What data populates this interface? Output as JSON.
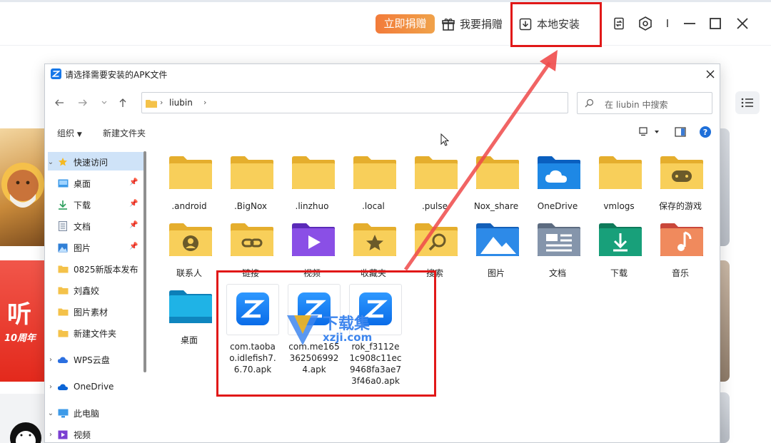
{
  "app": {
    "donate_now": "立即捐赠",
    "want_donate": "我要捐赠",
    "local_install": "本地安装",
    "separator": "I"
  },
  "dialog": {
    "title": "请选择需要安装的APK文件",
    "path_segment": "liubin",
    "search_placeholder": "在 liubin 中搜索",
    "organize": "组织",
    "new_folder": "新建文件夹"
  },
  "nav": {
    "items": [
      {
        "label": "快速访问"
      },
      {
        "label": "桌面"
      },
      {
        "label": "下载"
      },
      {
        "label": "文档"
      },
      {
        "label": "图片"
      },
      {
        "label": "0825新版本发布"
      },
      {
        "label": "刘鑫姣"
      },
      {
        "label": "图片素材"
      },
      {
        "label": "新建文件夹"
      },
      {
        "label": "WPS云盘"
      },
      {
        "label": "OneDrive"
      },
      {
        "label": "此电脑"
      },
      {
        "label": "视频"
      }
    ]
  },
  "files": {
    "row1": [
      {
        "label": ".android"
      },
      {
        "label": ".BigNox"
      },
      {
        "label": ".linzhuo"
      },
      {
        "label": ".local"
      },
      {
        "label": ".pulse"
      },
      {
        "label": "Nox_share"
      },
      {
        "label": "OneDrive"
      },
      {
        "label": "vmlogs"
      },
      {
        "label": "保存的游戏"
      }
    ],
    "row2": [
      {
        "label": "联系人"
      },
      {
        "label": "链接"
      },
      {
        "label": "视频"
      },
      {
        "label": "收藏夹"
      },
      {
        "label": "搜索"
      },
      {
        "label": "图片"
      },
      {
        "label": "文档"
      },
      {
        "label": "下载"
      },
      {
        "label": "音乐"
      }
    ],
    "row3": [
      {
        "label": "桌面"
      }
    ],
    "apks": [
      {
        "label": "com.taobao.idlefish7.6.70.apk"
      },
      {
        "label": "com.me1653625069924.apk"
      },
      {
        "label": "rok_f3112e1c908c11ec9468fa3ae73f46a0.apk"
      }
    ]
  },
  "watermark": {
    "line1": "下载集",
    "line2": "xzji.com"
  },
  "left_app": {
    "card_text": "听",
    "card_sub": "10周年"
  },
  "colors": {
    "accent_orange": "#f27b3a",
    "highlight_red": "#e11818",
    "folder_yellow": "#f6c94a",
    "apk_blue": "#1677e8"
  }
}
